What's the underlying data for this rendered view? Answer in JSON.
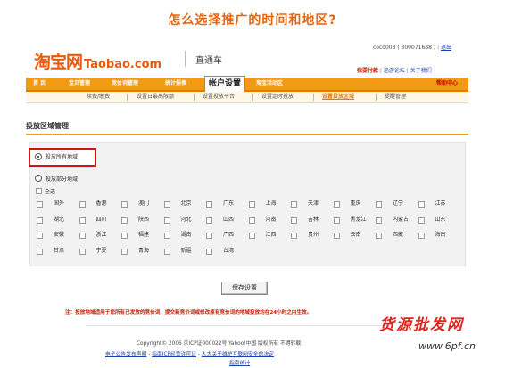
{
  "page_title": "怎么选择推广的时间和地区?",
  "brand": {
    "logo_cn": "淘宝网",
    "logo_en": "Taobao.com",
    "product": "直通车"
  },
  "account": {
    "user": "coco003 ( 300071688 )",
    "exit": "退出"
  },
  "toplinks": {
    "coupon": "我要付款",
    "forum": "巡游论坛",
    "about": "关于我们"
  },
  "nav": {
    "items": [
      "首 页",
      "宝贝管理",
      "竞价词管理",
      "统计报表",
      "帐户设置",
      "淘宝活动区"
    ],
    "help": "帮助中心"
  },
  "subnav": {
    "items": [
      "续费/缴费",
      "设置日最高限额",
      "设置投放平台",
      "设置定时投放",
      "设置投放区域",
      "提醒管理"
    ]
  },
  "section_title": "投放区域管理",
  "options": {
    "all": "投放所有地域",
    "partial": "投放部分地域",
    "select_all": "全选"
  },
  "regions": [
    [
      "国外",
      "香港",
      "澳门",
      "北京",
      "广东",
      "上海",
      "天津",
      "重庆",
      "辽宁",
      "江苏"
    ],
    [
      "湖北",
      "四川",
      "陕西",
      "河北",
      "山西",
      "河南",
      "吉林",
      "黑龙江",
      "内蒙古",
      "山东"
    ],
    [
      "安徽",
      "浙江",
      "福建",
      "湖南",
      "广西",
      "江西",
      "贵州",
      "云南",
      "西藏",
      "海南"
    ],
    [
      "甘肃",
      "宁夏",
      "青海",
      "新疆",
      "台湾"
    ]
  ],
  "save_button": "保存设置",
  "note": "注：投放地域适用于您所有已发放的竞价词，提交新竞价词或修改原有竞价词的地域投放均在24小时之内生效。",
  "footer": {
    "line1": "Copyright© 2006 京ICP证000022号  Yahoo!中国 版权所有  不得转载",
    "line2a": "电子公告发布声明",
    "line2b": "指南ICP经营许可证",
    "line2c": "人大关于维护互联网安全的决定",
    "line3": "指南统计"
  },
  "watermark": {
    "cn": "货源批发网",
    "url": "www.6pf.cn"
  },
  "colors": {
    "accent": "#f39a14",
    "title": "#e8640c",
    "alert": "#d11414"
  }
}
